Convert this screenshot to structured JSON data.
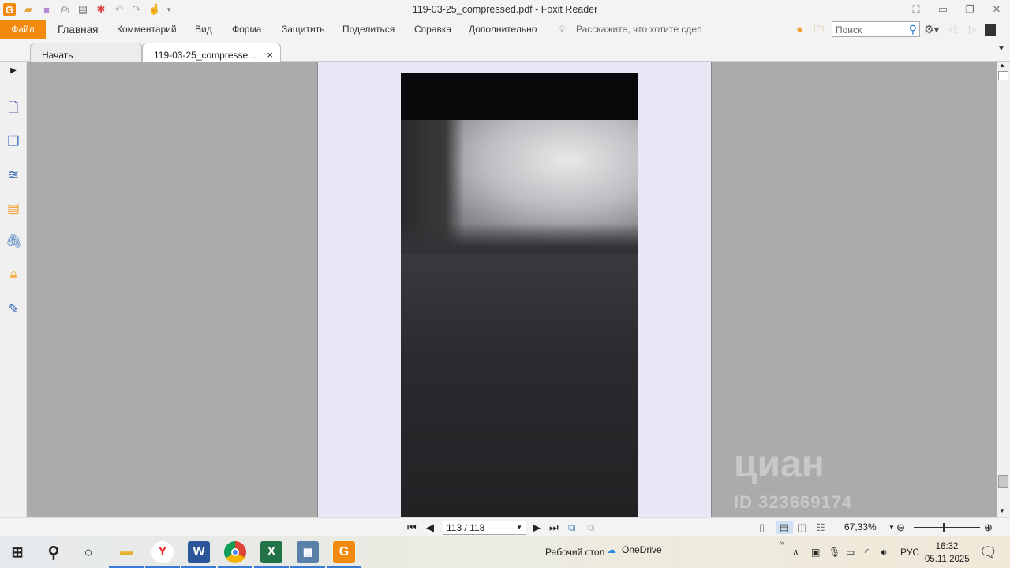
{
  "window": {
    "title": "119-03-25_compressed.pdf - Foxit Reader"
  },
  "menu": {
    "file": "Файл",
    "items": [
      "Главная",
      "Комментарий",
      "Вид",
      "Форма",
      "Защитить",
      "Поделиться",
      "Справка",
      "Дополнительно"
    ],
    "tell_me": "Расскажите, что хотите сдел",
    "search_placeholder": "Поиск"
  },
  "tabs": [
    {
      "label": "Начать"
    },
    {
      "label": "119-03-25_compresse...",
      "close": "×"
    }
  ],
  "sidebar": {
    "icons": [
      "bookmark-icon",
      "pages-icon",
      "layers-icon",
      "comments-icon",
      "attachment-icon",
      "security-icon",
      "signature-icon"
    ]
  },
  "watermark": {
    "brand": "циан",
    "id": "ID 323669174"
  },
  "statusbar": {
    "page_value": "113 / 118",
    "zoom": "67,33%",
    "zoom_fraction": 0.45
  },
  "taskbar": {
    "desktop_label": "Рабочий стол",
    "onedrive": "OneDrive",
    "language": "РУС",
    "time": "16:32",
    "date": "05.11.2025",
    "overflow": "»"
  },
  "colors": {
    "accent": "#f28a10",
    "doc_bg": "#ababab",
    "page_bg": "#ebe6f5"
  }
}
